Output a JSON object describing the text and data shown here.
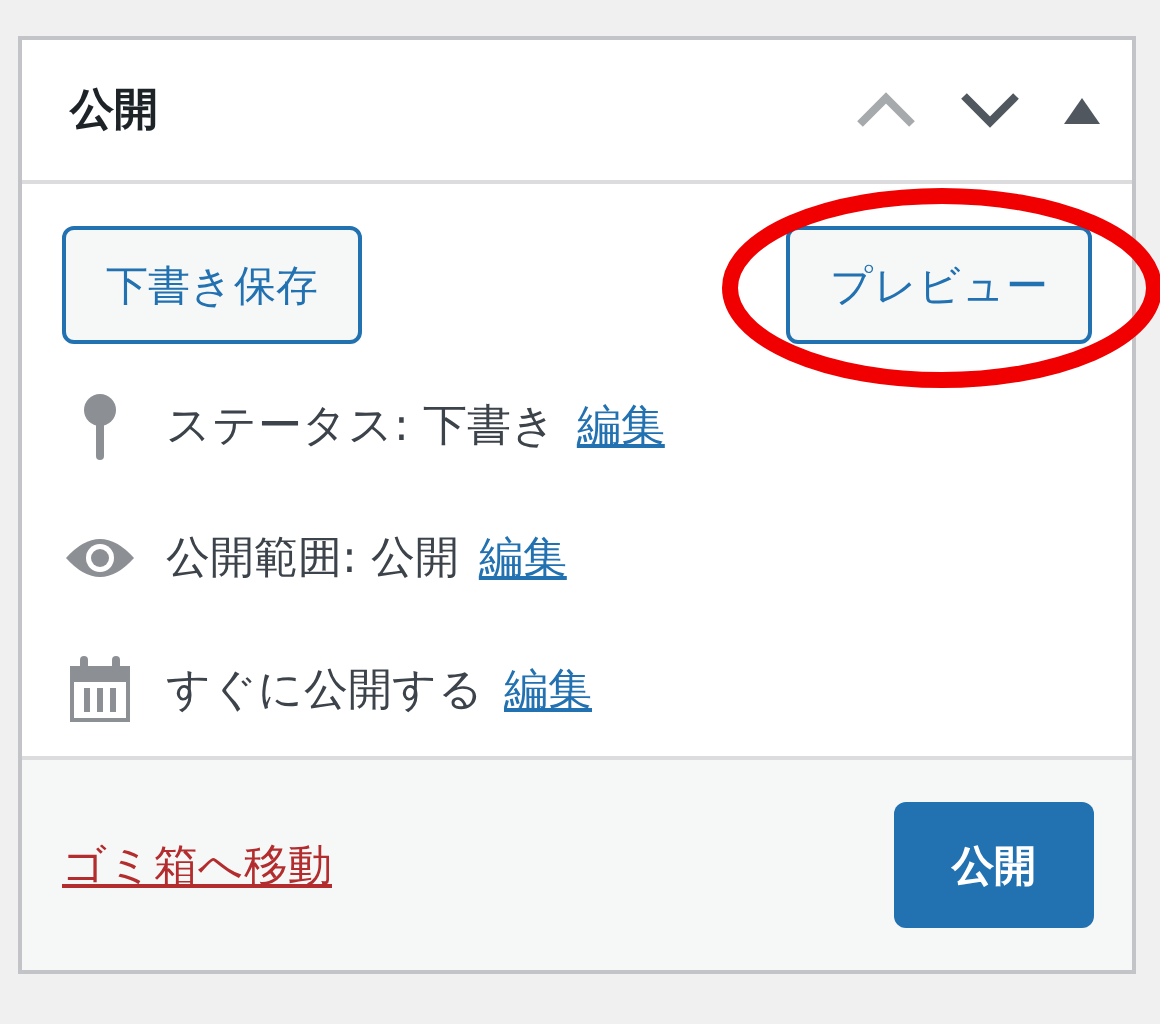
{
  "panel": {
    "title": "公開",
    "controls": [
      {
        "kind": "up",
        "disabled": true
      },
      {
        "kind": "down",
        "disabled": false
      },
      {
        "kind": "toggle",
        "disabled": false
      }
    ]
  },
  "actions": [
    {
      "label": "下書き保存"
    },
    {
      "label": "プレビュー"
    }
  ],
  "meta": [
    {
      "kind": "status",
      "text": "ステータス: 下書き",
      "link": "編集"
    },
    {
      "kind": "visibility",
      "text": "公開範囲: 公開",
      "link": "編集"
    },
    {
      "kind": "schedule",
      "text": "すぐに公開する",
      "link": "編集"
    }
  ],
  "footer": {
    "trash": "ゴミ箱へ移動",
    "publish": "公開"
  },
  "annotation": {
    "kind": "ellipse"
  }
}
